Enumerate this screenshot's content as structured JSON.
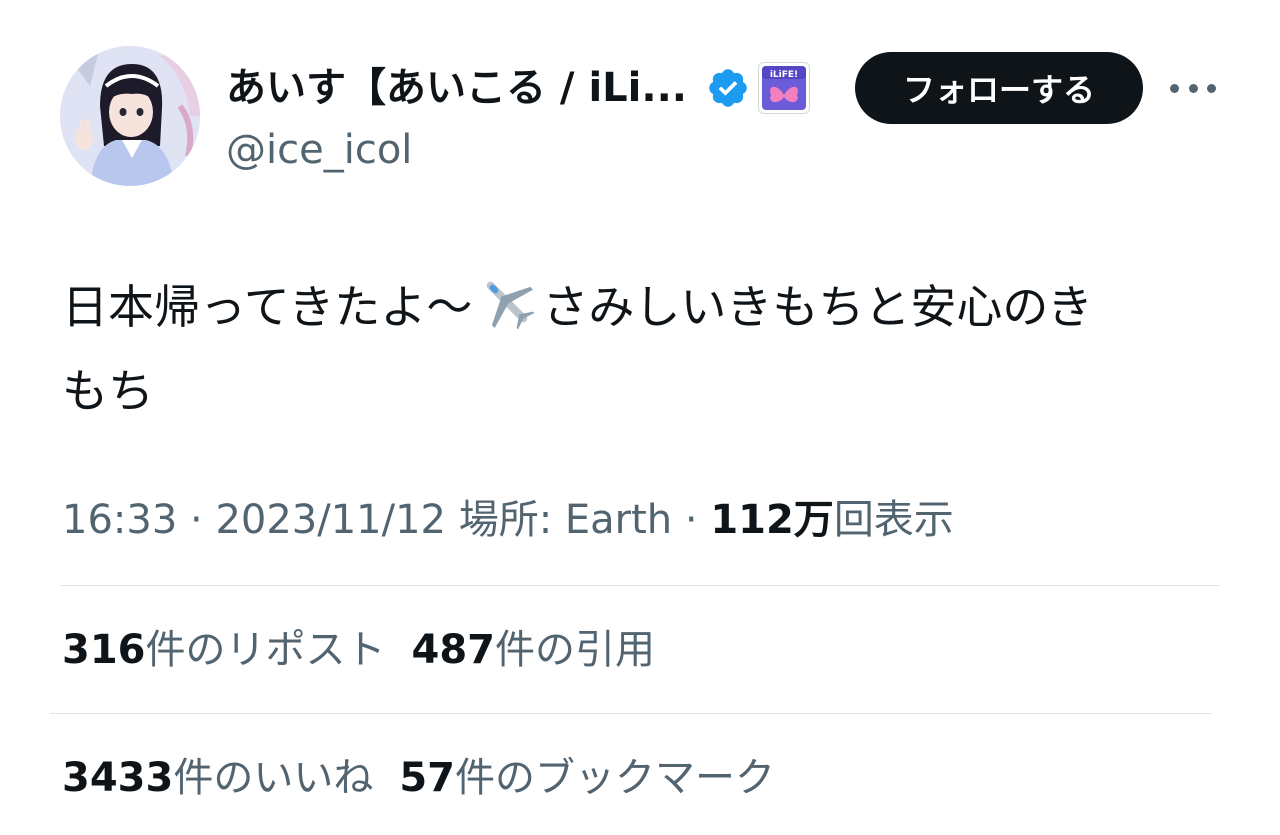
{
  "header": {
    "display_name": "あいす【あいこる / iLi...",
    "handle": "@ice_icol",
    "follow_label": "フォローする",
    "verified_icon": "verified-badge-icon",
    "affiliate_icon": "affiliate-badge-icon",
    "affiliate_badge_text": "iLiFE!",
    "more_icon": "more-options-icon",
    "accent_color": "#1d9bf0"
  },
  "tweet": {
    "line1_before": "日本帰ってきたよ〜",
    "plane_icon": "airplane-emoji-icon",
    "line1_after": "さみしいきもちと安心のき",
    "line2": "もち"
  },
  "meta": {
    "time": "16:33",
    "sep1": " · ",
    "date": "2023/11/12",
    "location": " 場所: Earth",
    "sep2": " · ",
    "views_count": "112万",
    "views_label": "回表示"
  },
  "stats": {
    "reposts_count": "316",
    "reposts_label": "件のリポスト",
    "quotes_count": "487",
    "quotes_label": "件の引用",
    "likes_count": "3433",
    "likes_label": "件のいいね",
    "bookmarks_count": "57",
    "bookmarks_label": "件のブックマーク"
  }
}
